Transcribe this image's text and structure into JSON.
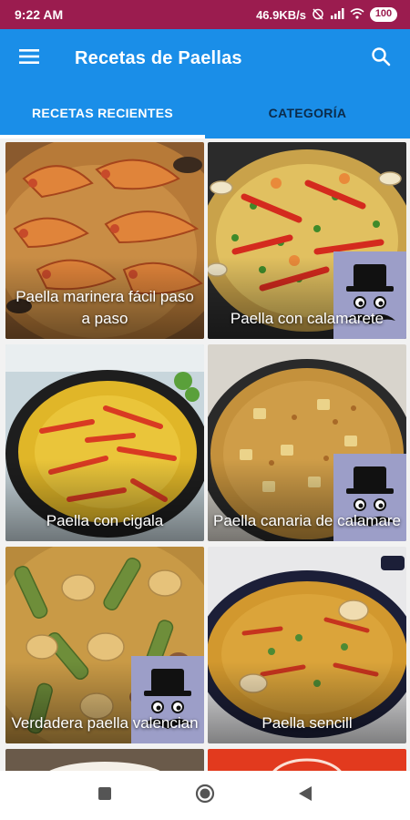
{
  "status_bar": {
    "time": "9:22 AM",
    "network_speed": "46.9KB/s",
    "battery": "100"
  },
  "app_bar": {
    "title": "Recetas de Paellas",
    "menu_icon": "hamburger-menu-icon",
    "search_icon": "search-icon"
  },
  "tabs": [
    {
      "label": "RECETAS RECIENTES",
      "selected": true
    },
    {
      "label": "CATEGORÍA",
      "selected": false
    }
  ],
  "recipes": [
    {
      "title": "Paella marinera fácil paso a paso",
      "has_badge": false
    },
    {
      "title": "Paella con calamarete",
      "has_badge": true
    },
    {
      "title": "Paella con cigala",
      "has_badge": false
    },
    {
      "title": "Paella canaria de calamare",
      "has_badge": true
    },
    {
      "title": "Verdadera paella valencian",
      "has_badge": true
    },
    {
      "title": "Paella sencill",
      "has_badge": false
    }
  ],
  "colors": {
    "status_bar": "#9b1c4f",
    "app_bar": "#1a8ee8",
    "tab_indicator": "#ffffff",
    "inactive_tab_text": "#0b2b4a"
  },
  "nav_bar": {
    "recents_icon": "square-recents-icon",
    "home_icon": "circle-home-icon",
    "back_icon": "triangle-back-icon"
  }
}
